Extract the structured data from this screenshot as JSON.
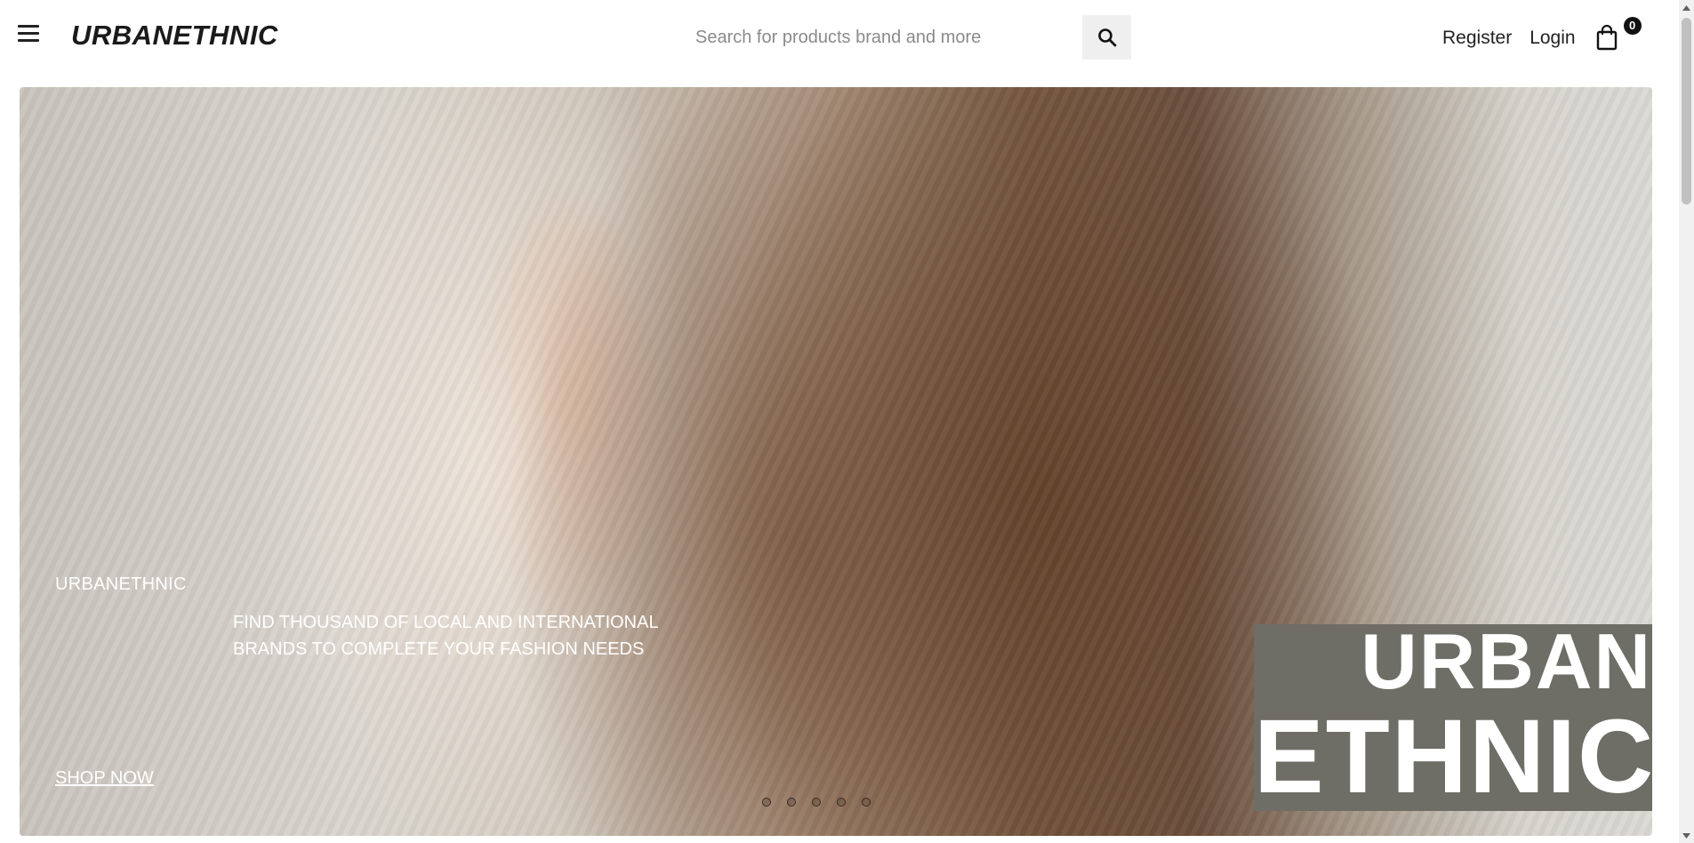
{
  "header": {
    "brand": "URBANETHNIC",
    "search": {
      "placeholder": "Search for products brand and more"
    },
    "nav": {
      "register": "Register",
      "login": "Login"
    },
    "cart_count": "0",
    "icons": [
      "menu-icon",
      "search-icon",
      "shopping-bag-icon"
    ]
  },
  "hero": {
    "brand_label": "URBANETHNIC",
    "tagline": "FIND THOUSAND OF LOCAL AND INTERNATIONAL BRANDS TO COMPLETE YOUR FASHION NEEDS",
    "cta": "SHOP NOW",
    "slides_count": 5,
    "block_line1": "URBAN",
    "block_line2": "ETHNIC",
    "block_color": "#6e6d66"
  }
}
